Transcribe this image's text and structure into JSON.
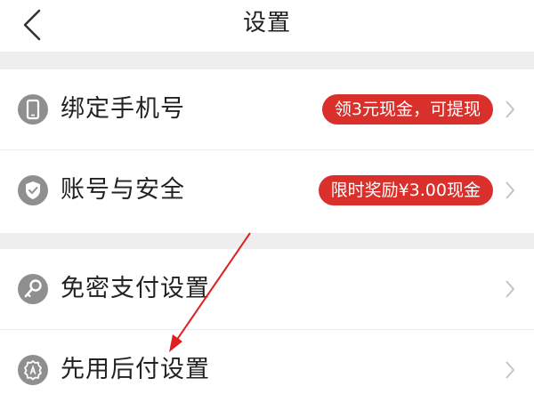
{
  "header": {
    "title": "设置",
    "back_icon": "chevron-left-icon"
  },
  "settings_items": [
    {
      "label": "绑定手机号",
      "icon": "phone-icon",
      "badge": "领3元现金，可提现"
    },
    {
      "label": "账号与安全",
      "icon": "shield-check-icon",
      "badge": "限时奖励¥3.00现金"
    },
    {
      "label": "免密支付设置",
      "icon": "key-icon"
    },
    {
      "label": "先用后付设置",
      "icon": "badge-icon"
    }
  ],
  "colors": {
    "badge_red": "#d9302c",
    "icon_gray": "#8f8f8f",
    "section_gap": "#eeeeee",
    "annotation_arrow": "#e02020"
  }
}
